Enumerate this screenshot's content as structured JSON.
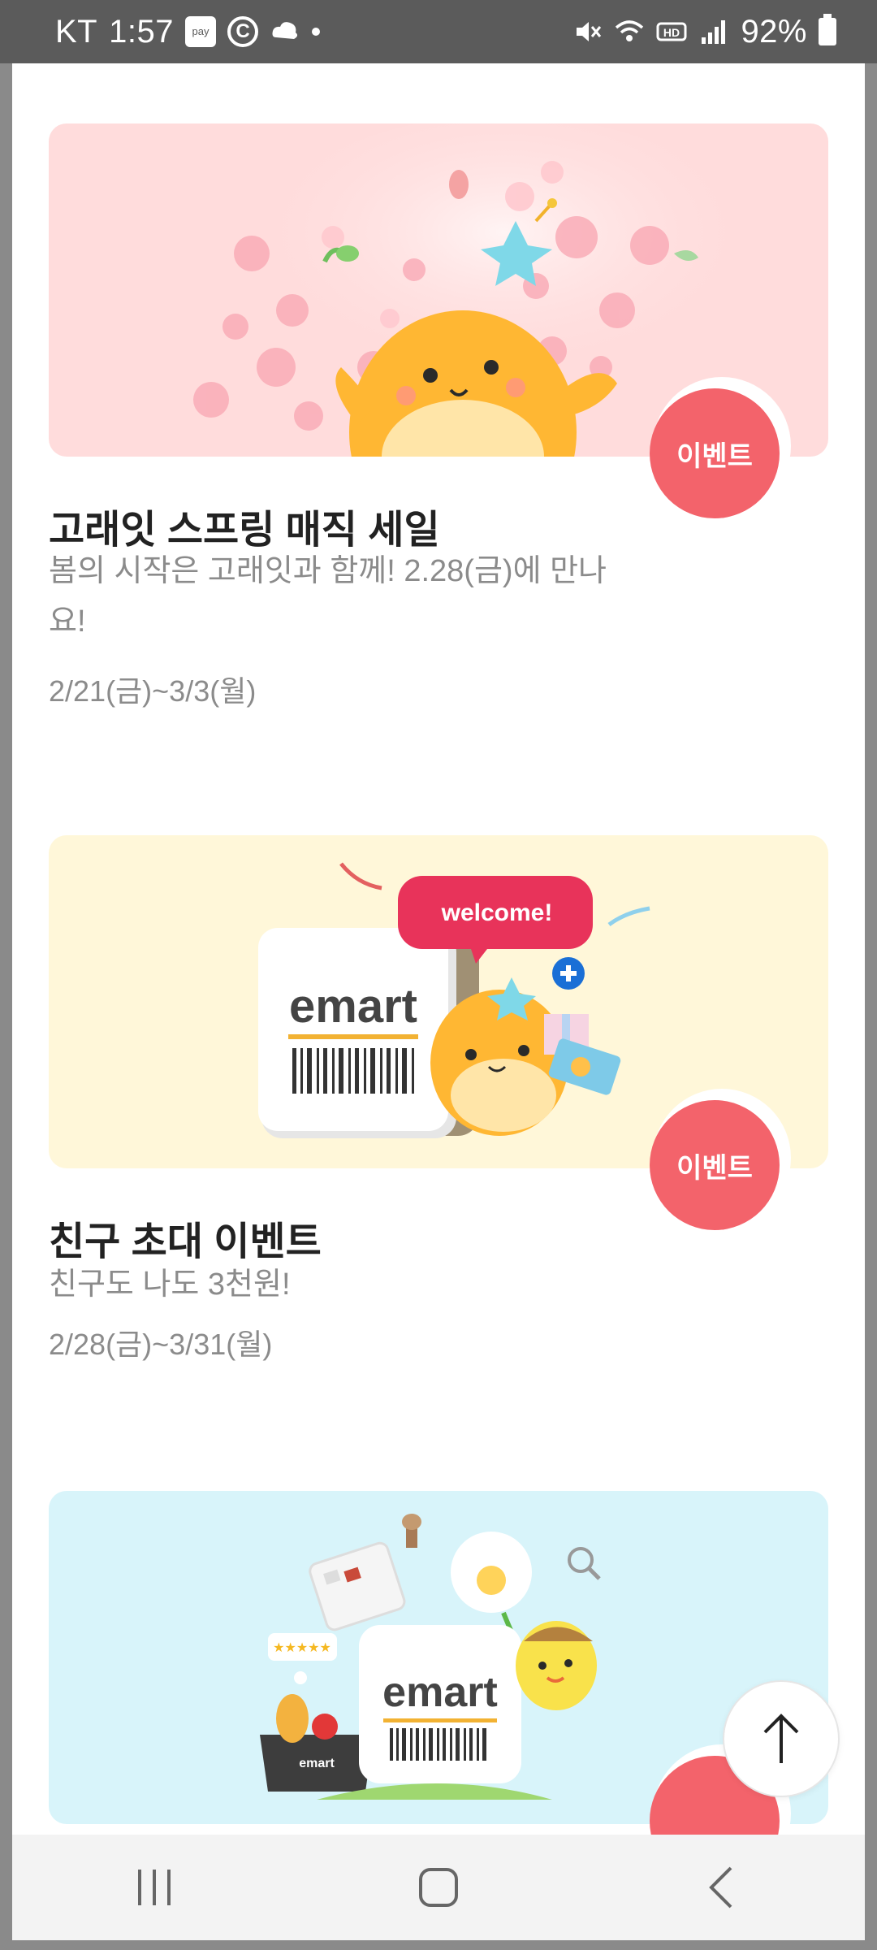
{
  "status_bar": {
    "carrier": "KT",
    "time": "1:57",
    "battery": "92%",
    "icons": [
      "pay-icon",
      "c-icon",
      "cloud-icon",
      "dot-icon",
      "mute-icon",
      "wifi-icon",
      "hd-icon",
      "signal-icon",
      "battery-icon"
    ]
  },
  "events": [
    {
      "title": "고래잇 스프링 매직 세일",
      "description": "봄의 시작은 고래잇과 함께! 2.28(금)에 만나요!",
      "date": "2/21(금)~3/3(월)",
      "badge": "이벤트",
      "banner_bg": "#ffdcdc"
    },
    {
      "title": "친구 초대 이벤트",
      "description": "친구도 나도 3천원!",
      "date": "2/28(금)~3/31(월)",
      "badge": "이벤트",
      "banner_bg": "#fff7d9",
      "banner_text": {
        "welcome": "welcome!",
        "brand": "emart"
      }
    },
    {
      "banner_bg": "#d8f4fa",
      "banner_text": {
        "brand": "emart",
        "basket_brand": "emart"
      }
    }
  ],
  "colors": {
    "badge": "#f3636b",
    "title": "#222222",
    "secondary_text": "#8b8b8b"
  },
  "nav": {
    "icons": [
      "recent-apps-icon",
      "home-icon",
      "back-icon"
    ]
  }
}
